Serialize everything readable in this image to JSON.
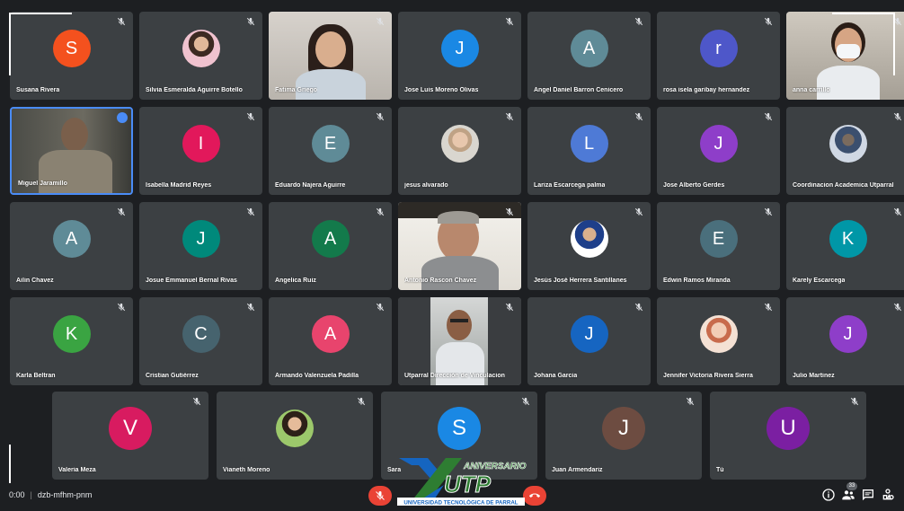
{
  "meeting": {
    "time": "0:00",
    "code": "dzb-mfhm-pnm",
    "participant_count": "33"
  },
  "logo": {
    "word": "ANIVERSARIO",
    "mark": "UTP",
    "university": "UNIVERSIDAD TECNOLÓGICA DE PARRAL"
  },
  "participants": [
    {
      "name": "Susana Rivera",
      "initial": "S",
      "color": "#f4511e",
      "type": "letter"
    },
    {
      "name": "Silvia Esmeralda Aguirre Botello",
      "type": "photo"
    },
    {
      "name": "Fatima Griego",
      "type": "video"
    },
    {
      "name": "Jose Luis Moreno Olivas",
      "initial": "J",
      "color": "#1a88e4",
      "type": "letter"
    },
    {
      "name": "Angel Daniel Barron Cenicero",
      "initial": "A",
      "color": "#5f8b97",
      "type": "letter"
    },
    {
      "name": "rosa isela garibay hernandez",
      "initial": "r",
      "color": "#4e57c9",
      "type": "letter"
    },
    {
      "name": "anna carrillo",
      "type": "video"
    },
    {
      "name": "Miguel Jaramillo",
      "type": "video"
    },
    {
      "name": "Isabella Madrid Reyes",
      "initial": "I",
      "color": "#e2185b",
      "type": "letter"
    },
    {
      "name": "Eduardo Najera Aguirre",
      "initial": "E",
      "color": "#5f8b97",
      "type": "letter"
    },
    {
      "name": "jesus alvarado",
      "type": "photo"
    },
    {
      "name": "Lariza Escarcega palma",
      "initial": "L",
      "color": "#4e7ad6",
      "type": "letter"
    },
    {
      "name": "Jose Alberto Gerdes",
      "initial": "J",
      "color": "#8e3ec9",
      "type": "letter"
    },
    {
      "name": "Coordinacion Academica Utparral",
      "type": "photo"
    },
    {
      "name": "Ailin Chavez",
      "initial": "A",
      "color": "#5f8b97",
      "type": "letter"
    },
    {
      "name": "Josue Emmanuel Bernal Rivas",
      "initial": "J",
      "color": "#00897b",
      "type": "letter"
    },
    {
      "name": "Angelica Ruiz",
      "initial": "A",
      "color": "#137a4b",
      "type": "letter"
    },
    {
      "name": "Antonio Rascon Chavez",
      "type": "video"
    },
    {
      "name": "Jesús José Herrera Santillanes",
      "type": "photo"
    },
    {
      "name": "Edwin Ramos Miranda",
      "initial": "E",
      "color": "#4a6f7c",
      "type": "letter"
    },
    {
      "name": "Karely Escarcega",
      "initial": "K",
      "color": "#0097a7",
      "type": "letter"
    },
    {
      "name": "Karla Beltran",
      "initial": "K",
      "color": "#3aa442",
      "type": "letter"
    },
    {
      "name": "Cristian Gutiérrez",
      "initial": "C",
      "color": "#46636e",
      "type": "letter"
    },
    {
      "name": "Armando Valenzuela Padilla",
      "initial": "A",
      "color": "#e8446d",
      "type": "letter"
    },
    {
      "name": "Utparral Dirección de Vinculacion",
      "type": "video"
    },
    {
      "name": "Johana Garcia",
      "initial": "J",
      "color": "#1665c1",
      "type": "letter"
    },
    {
      "name": "Jennifer Victoria Rivera Sierra",
      "type": "photo"
    },
    {
      "name": "Julio Martinez",
      "initial": "J",
      "color": "#8e3ec9",
      "type": "letter"
    },
    {
      "name": "Valeria Meza",
      "initial": "V",
      "color": "#d81b60",
      "type": "letter"
    },
    {
      "name": "Vianeth Moreno",
      "type": "photo"
    },
    {
      "name": "Sara",
      "initial": "S",
      "color": "#1a88e4",
      "type": "letter"
    },
    {
      "name": "Juan Armendariz",
      "initial": "J",
      "color": "#6d4c41",
      "type": "letter"
    },
    {
      "name": "Tú",
      "initial": "U",
      "color": "#7b1fa2",
      "type": "letter"
    }
  ],
  "icons": {
    "mic_off": "mic-off-icon",
    "hangup": "phone-hangup-icon",
    "info": "info-icon",
    "people": "people-icon",
    "chat": "chat-icon",
    "activities": "activities-icon"
  }
}
